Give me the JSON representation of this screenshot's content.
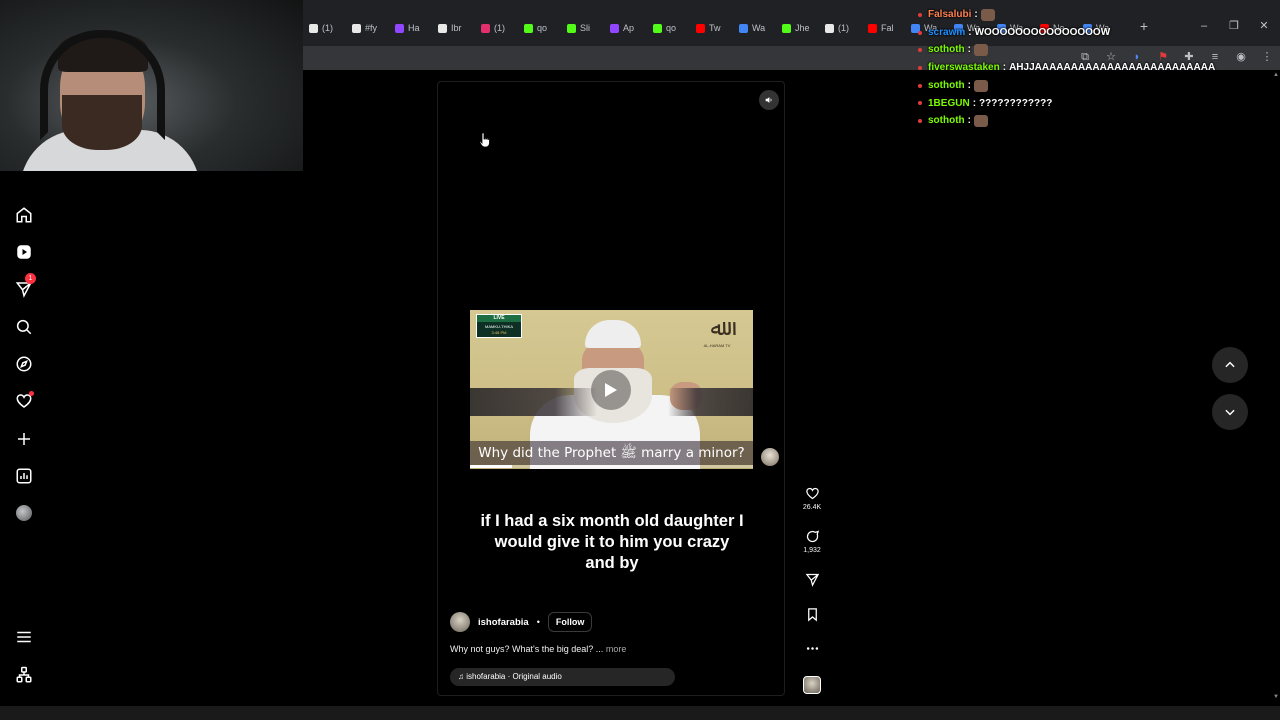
{
  "browser": {
    "tabs": [
      {
        "label": "(1)",
        "color": "#e8e8e8"
      },
      {
        "label": "#fy",
        "color": "#e8e8e8"
      },
      {
        "label": "Ha",
        "color": "#9146ff"
      },
      {
        "label": "Ibr",
        "color": "#e8e8e8"
      },
      {
        "label": "(1)",
        "color": "#e1306c"
      },
      {
        "label": "qo",
        "color": "#53fc18"
      },
      {
        "label": "Sli",
        "color": "#53fc18"
      },
      {
        "label": "Ap",
        "color": "#9146ff"
      },
      {
        "label": "qo",
        "color": "#53fc18"
      },
      {
        "label": "Tw",
        "color": "#ff0000"
      },
      {
        "label": "Wa",
        "color": "#4285f4"
      },
      {
        "label": "Jhe",
        "color": "#53fc18"
      },
      {
        "label": "(1)",
        "color": "#e8e8e8"
      },
      {
        "label": "Fal",
        "color": "#ff0000"
      },
      {
        "label": "Wa",
        "color": "#4285f4"
      },
      {
        "label": "Wa",
        "color": "#4285f4"
      },
      {
        "label": "Wa",
        "color": "#4285f4"
      },
      {
        "label": "Ne",
        "color": "#ff0000"
      },
      {
        "label": "Wa",
        "color": "#4285f4"
      }
    ],
    "new_tab": "+",
    "minimize": "–",
    "maximize": "❐",
    "close": "✕"
  },
  "chat": [
    {
      "user": "Falsalubi",
      "color": "#ff7f50",
      "message": ""
    },
    {
      "user": "scrawm",
      "color": "#1e90ff",
      "message": "WOOOOOOOOOOOOOOOW"
    },
    {
      "user": "sothoth",
      "color": "#7cfc00",
      "message": ""
    },
    {
      "user": "fiverswastaken",
      "color": "#7cfc00",
      "message": "AHJJAAAAAAAAAAAAAAAAAAAAAAAAA"
    },
    {
      "user": "sothoth",
      "color": "#7cfc00",
      "message": ""
    },
    {
      "user": "1BEGUN",
      "color": "#7cfc00",
      "message": "????????????"
    },
    {
      "user": "sothoth",
      "color": "#7cfc00",
      "message": ""
    }
  ],
  "sidebar": {
    "notifications_badge": "1"
  },
  "reel": {
    "video": {
      "live_label": "LIVE",
      "live_location": "MAMKU-THIKA",
      "live_time": "3:48 PM",
      "logo_glyph": "ﷲ",
      "logo_text": "AL-HARAM TV",
      "caption": "Why did the Prophet ﷺ marry a minor?",
      "progress": 0.15
    },
    "subtitle": "if I had a six month old daughter I would give it to him you crazy and by",
    "author": "ishofarabia",
    "separator": "•",
    "follow_label": "Follow",
    "caption_text": "Why not guys? What's the big deal? ...",
    "caption_more": "more",
    "audio": "ishofarabia · Original audio",
    "likes": "26.4K",
    "comments": "1,932"
  },
  "colors": {
    "accent_badge": "#ff3040",
    "background": "#000000"
  }
}
